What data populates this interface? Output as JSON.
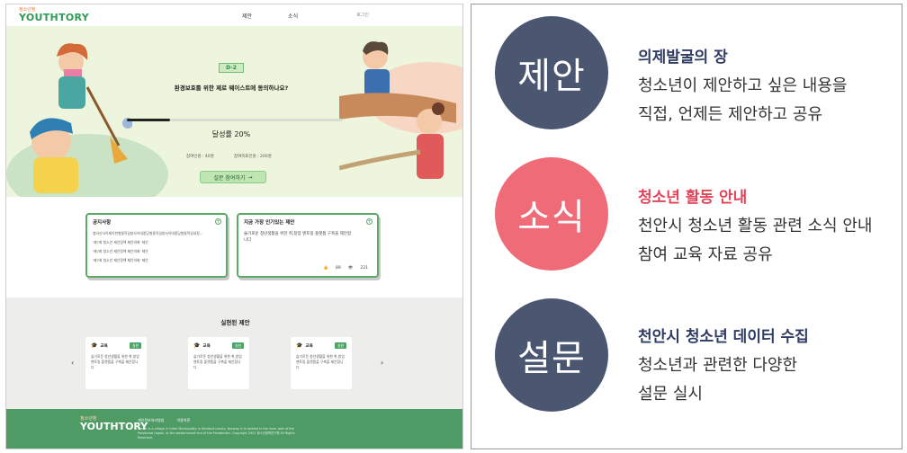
{
  "site": {
    "logo_small": "청소년청",
    "logo_brand": "YOUTHTORY",
    "nav": [
      "제안",
      "소식"
    ],
    "login": "로그인"
  },
  "hero": {
    "dday": "D-2",
    "question": "환경보호를 위한 제로 웨이스트에 동의하나요?",
    "progress_percent": 20,
    "rate_label": "달성률 20%",
    "participants": "참여인원 : 40명",
    "target": "참여목표인원 : 200명",
    "cta": "설문 참여하기",
    "cta_arrow": "→"
  },
  "notice_card": {
    "title": "공지사항",
    "lines": [
      "청라산사이제이천벌들작길방사이대중당벌들작길방사이대중당벌들적길내정...",
      "'제7회 청소년 제안정책 제안의회' 제안",
      "'제7회 청소년 제안정책 제안의회' 제안",
      "'제7회 청소년 제안정책 제안의회' 제안"
    ]
  },
  "popular_card": {
    "title": "지금 가장 인기있는 제안",
    "body": "슬기로운 청년생활을 위한 취,창업 멘토링 플랫폼 구축을 제안합니다",
    "likes": "89",
    "views": "221"
  },
  "done": {
    "title": "실현된 제안",
    "prev": "‹",
    "next": "›",
    "cards": [
      {
        "category": "교육",
        "badge": "실현",
        "text": "슬기로운 청년생활을 위한 취,창업 멘토링 플랫폼을 구축을 제안합니다"
      },
      {
        "category": "교육",
        "badge": "실현",
        "text": "슬기로운 청년생활을 위한 취,창업 멘토링 플랫폼을 구축을 제안합니다"
      },
      {
        "category": "교육",
        "badge": "실현",
        "text": "슬기로운 청년생활을 위한 취,창업 멘토링 플랫폼을 구축을 제안합니다"
      }
    ]
  },
  "footer": {
    "logo_small": "청소년청",
    "logo_brand": "YOUTHTORY",
    "links": [
      "개인정보처리방침",
      "이용약관"
    ],
    "info": "Lorem is a village in Orion Municipality in Smdand county, Norway. It is located in the inner part of the Porsforord region, at the westernmost end of the Porsfjorden. Copyright 2021 청소년정책연구원 All Rights Reserved."
  },
  "panel": {
    "items": [
      {
        "circle": "제안",
        "color": "#4b5670",
        "title": "의제발굴의 장",
        "title_color": "#2f3c63",
        "desc1": "청소년이 제안하고 싶은 내용을",
        "desc2": "직접, 언제든 제안하고 공유"
      },
      {
        "circle": "소식",
        "color": "#ef6b78",
        "title": "청소년 활동 안내",
        "title_color": "#e0455a",
        "desc1": "천안시 청소년 활동 관련 소식 안내",
        "desc2": "참여 교육 자료 공유"
      },
      {
        "circle": "설문",
        "color": "#4b5670",
        "title": "천안시 청소년 데이터 수집",
        "title_color": "#2f3c63",
        "desc1": "청소년과 관련한 다양한",
        "desc2": "설문 실시"
      }
    ]
  }
}
